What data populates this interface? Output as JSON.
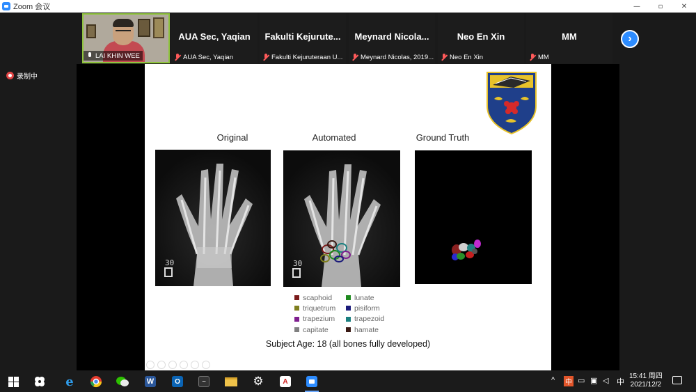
{
  "window": {
    "title": "Zoom 会议",
    "controls": [
      "—",
      "▫",
      "✕"
    ]
  },
  "participants": [
    {
      "name": "",
      "label": "LAI KHIN WEE",
      "muted": false,
      "video": true,
      "active": true
    },
    {
      "name": "AUA Sec, Yaqian",
      "label": "AUA Sec, Yaqian",
      "muted": true
    },
    {
      "name": "Fakulti  Kejurute...",
      "label": "Fakulti Kejuruteraan U...",
      "muted": true
    },
    {
      "name": "Meynard  Nicola...",
      "label": "Meynard Nicolas, 2019...",
      "muted": true
    },
    {
      "name": "Neo En Xin",
      "label": "Neo En Xin",
      "muted": true
    },
    {
      "name": "MM",
      "label": "MM",
      "muted": true
    }
  ],
  "next_page_icon": "chevron-right-icon",
  "recording": {
    "label": "录制中",
    "color": "#e04444"
  },
  "slide": {
    "captions": {
      "original": "Original",
      "automated": "Automated",
      "ground_truth": "Ground Truth"
    },
    "legend": [
      {
        "label": "scaphoid",
        "color": "#7a1a1a"
      },
      {
        "label": "lunate",
        "color": "#1f8a1f"
      },
      {
        "label": "triquetrum",
        "color": "#7f7f1f"
      },
      {
        "label": "pisiform",
        "color": "#1a1a7a"
      },
      {
        "label": "trapezium",
        "color": "#7f1f8f"
      },
      {
        "label": "trapezoid",
        "color": "#1a7f7f"
      },
      {
        "label": "capitate",
        "color": "#808080"
      },
      {
        "label": "hamate",
        "color": "#3a1a14"
      }
    ],
    "subject": "Subject Age: 18 (all bones fully developed)",
    "xray_marker": "30"
  },
  "taskbar": {
    "apps": [
      "windows-start",
      "pinwheel-app",
      "internet-explorer",
      "chrome",
      "wechat",
      "word",
      "outlook",
      "media-app",
      "file-explorer",
      "settings",
      "pdf-reader",
      "zoom"
    ],
    "tray": {
      "up_arrow": "^",
      "ime": "中",
      "lang": "中"
    },
    "time": "15:41 周四",
    "date": "2021/12/2"
  }
}
